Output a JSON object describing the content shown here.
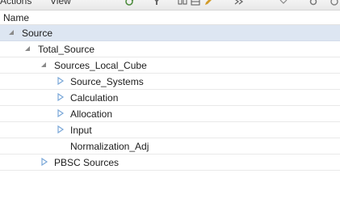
{
  "toolbar": {
    "menu": [
      {
        "label": "Actions"
      },
      {
        "label": "View"
      }
    ],
    "icons": [
      "refresh-icon",
      "filter-icon",
      "collapse-icon",
      "grid-icon",
      "edit-icon",
      "expand-icon",
      "more-icon",
      "settings-icon"
    ]
  },
  "grid": {
    "header": {
      "name": "Name"
    }
  },
  "tree": [
    {
      "label": "Source",
      "state": "expanded",
      "selected": true
    },
    {
      "label": "Total_Source",
      "state": "expanded",
      "selected": false
    },
    {
      "label": "Sources_Local_Cube",
      "state": "expanded",
      "selected": false
    },
    {
      "label": "Source_Systems",
      "state": "collapsed",
      "selected": false
    },
    {
      "label": "Calculation",
      "state": "collapsed",
      "selected": false
    },
    {
      "label": "Allocation",
      "state": "collapsed",
      "selected": false
    },
    {
      "label": "Input",
      "state": "collapsed",
      "selected": false
    },
    {
      "label": "Normalization_Adj",
      "state": "leaf",
      "selected": false
    },
    {
      "label": "PBSC Sources",
      "state": "collapsed",
      "selected": false
    }
  ],
  "colors": {
    "selected_row": "#dde6f2",
    "toggle_collapsed": "#7aa7d8",
    "toggle_expanded": "#8a8a8a"
  }
}
